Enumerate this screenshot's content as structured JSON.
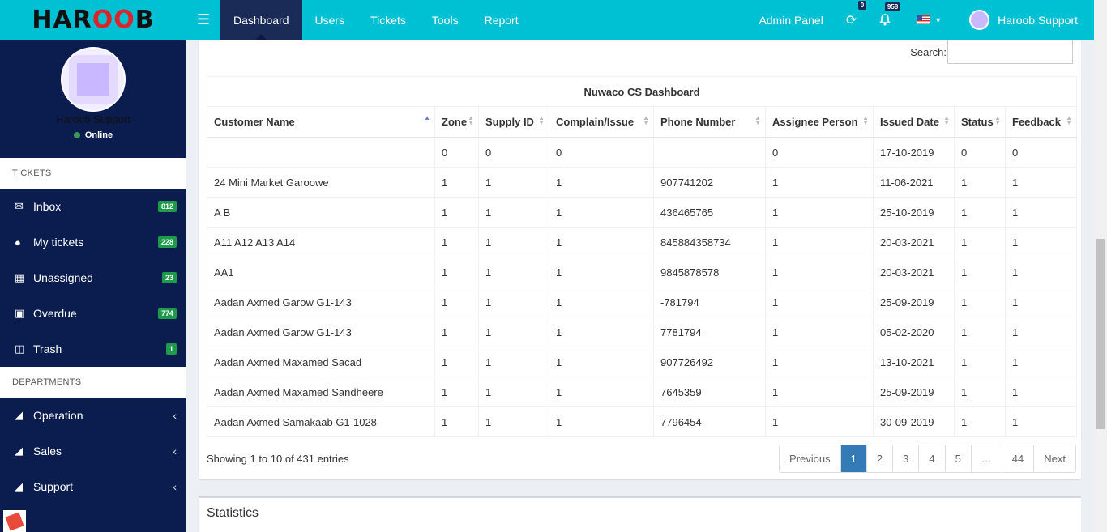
{
  "brand": {
    "logo_pre": "HAR",
    "logo_mid": "OO",
    "logo_post": "B"
  },
  "nav": {
    "items": [
      "Dashboard",
      "Users",
      "Tickets",
      "Tools",
      "Report"
    ],
    "active": "Dashboard"
  },
  "topbar": {
    "admin_panel": "Admin Panel",
    "sync_badge": "0",
    "bell_badge": "958",
    "user_name": "Haroob Support"
  },
  "sidebar": {
    "user_name": "Haroob Support",
    "status": "Online",
    "tickets_header": "TICKETS",
    "tickets": [
      {
        "label": "Inbox",
        "count": "812",
        "icon": "envelope-icon"
      },
      {
        "label": "My tickets",
        "count": "228",
        "icon": "user-icon"
      },
      {
        "label": "Unassigned",
        "count": "23",
        "icon": "grid-icon"
      },
      {
        "label": "Overdue",
        "count": "774",
        "icon": "calendar-x-icon"
      },
      {
        "label": "Trash",
        "count": "1",
        "icon": "trash-icon"
      }
    ],
    "departments_header": "DEPARTMENTS",
    "departments": [
      {
        "label": "Operation",
        "icon": "folder-open-icon"
      },
      {
        "label": "Sales",
        "icon": "folder-open-icon"
      },
      {
        "label": "Support",
        "icon": "folder-open-icon"
      }
    ]
  },
  "table": {
    "search_label": "Search:",
    "search_value": "",
    "caption": "Nuwaco CS Dashboard",
    "columns": [
      "Customer Name",
      "Zone",
      "Supply ID",
      "Complain/Issue",
      "Phone Number",
      "Assignee Person",
      "Issued Date",
      "Status",
      "Feedback"
    ],
    "rows": [
      [
        "",
        "0",
        "0",
        "0",
        "",
        "0",
        "17-10-2019",
        "0",
        "0"
      ],
      [
        "24 Mini Market Garoowe",
        "1",
        "1",
        "1",
        "907741202",
        "1",
        "11-06-2021",
        "1",
        "1"
      ],
      [
        "A B",
        "1",
        "1",
        "1",
        "436465765",
        "1",
        "25-10-2019",
        "1",
        "1"
      ],
      [
        "A11 A12 A13 A14",
        "1",
        "1",
        "1",
        "845884358734",
        "1",
        "20-03-2021",
        "1",
        "1"
      ],
      [
        "AA1",
        "1",
        "1",
        "1",
        "9845878578",
        "1",
        "20-03-2021",
        "1",
        "1"
      ],
      [
        "Aadan Axmed Garow G1-143",
        "1",
        "1",
        "1",
        "-781794",
        "1",
        "25-09-2019",
        "1",
        "1"
      ],
      [
        "Aadan Axmed Garow G1-143",
        "1",
        "1",
        "1",
        "7781794",
        "1",
        "05-02-2020",
        "1",
        "1"
      ],
      [
        "Aadan Axmed Maxamed Sacad",
        "1",
        "1",
        "1",
        "907726492",
        "1",
        "13-10-2021",
        "1",
        "1"
      ],
      [
        "Aadan Axmed Maxamed Sandheere",
        "1",
        "1",
        "1",
        "7645359",
        "1",
        "25-09-2019",
        "1",
        "1"
      ],
      [
        "Aadan Axmed Samakaab G1-1028",
        "1",
        "1",
        "1",
        "7796454",
        "1",
        "30-09-2019",
        "1",
        "1"
      ]
    ],
    "info": "Showing 1 to 10 of 431 entries"
  },
  "pagination": {
    "previous": "Previous",
    "pages": [
      "1",
      "2",
      "3",
      "4",
      "5",
      "…",
      "44"
    ],
    "active": "1",
    "next": "Next"
  },
  "statistics": {
    "title": "Statistics"
  },
  "colors": {
    "topbar": "#00c0d4",
    "sidebar": "#0b1d4f",
    "active_nav": "#1a2b57",
    "badge": "#1e9a4b",
    "page_active": "#337ab7"
  }
}
